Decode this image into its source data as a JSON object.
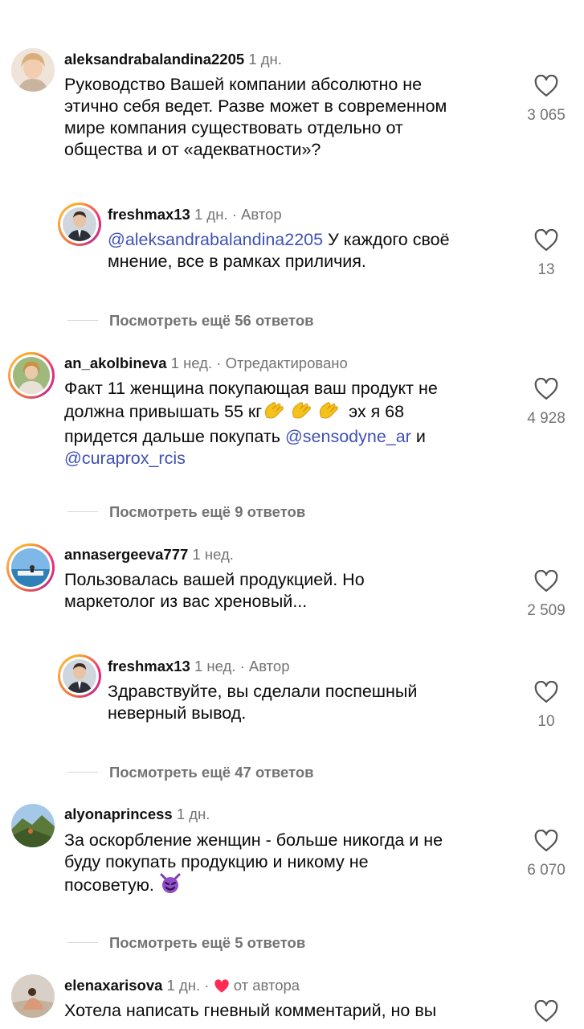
{
  "colors": {
    "mention": "#3f51b5",
    "meta": "#737373",
    "heart_red": "#ff2d55"
  },
  "comments": [
    {
      "username": "aleksandrabalandina2205",
      "time": "1 дн.",
      "text": "Руководство Вашей компании абсолютно не\nэтично себя ведет. Разве может в современном\nмире компания существовать отдельно от\nобщества и от «адекватности»?",
      "likes": "3 065"
    },
    {
      "username": "freshmax13",
      "time": "1 дн.",
      "author": "Автор",
      "mention": "@aleksandrabalandina2205",
      "text": " У каждого своё\nмнение, все в рамках приличия.",
      "likes": "13"
    },
    {
      "replies": "Посмотреть ещё 56 ответов"
    },
    {
      "username": "an_akolbineva",
      "time": "1 нед.",
      "edited": "Отредактировано",
      "text_line1": "Факт 11 женщина покупающая ваш продукт не",
      "text_line2a": "должна привышать 55 кг",
      "text_line2b": " эх я 68",
      "text_line3": "придется дальше покупать ",
      "mention1": "@sensodyne_ar",
      "text_and": " и",
      "mention2": "@curaprox_rcis",
      "likes": "4 928"
    },
    {
      "replies": "Посмотреть ещё 9 ответов"
    },
    {
      "username": "annasergeeva777",
      "time": "1 нед.",
      "text": "Пользовалась вашей продукцией. Но\nмаркетолог из вас хреновый...",
      "likes": "2 509"
    },
    {
      "username": "freshmax13",
      "time": "1 нед.",
      "author": "Автор",
      "text": "Здравствуйте, вы сделали поспешный\nневерный вывод.",
      "likes": "10"
    },
    {
      "replies": "Посмотреть ещё 47 ответов"
    },
    {
      "username": "alyonaprincess",
      "time": "1 дн.",
      "text": "За оскорбление женщин - больше никогда и не\nбуду покупать продукцию и никому не\nпосоветую. ",
      "likes": "6 070"
    },
    {
      "replies": "Посмотреть ещё 5 ответов"
    },
    {
      "username": "elenaxarisova",
      "time": "1 дн.",
      "from_author": "от автора",
      "text": "Хотела написать гневный комментарий, но вы"
    }
  ]
}
